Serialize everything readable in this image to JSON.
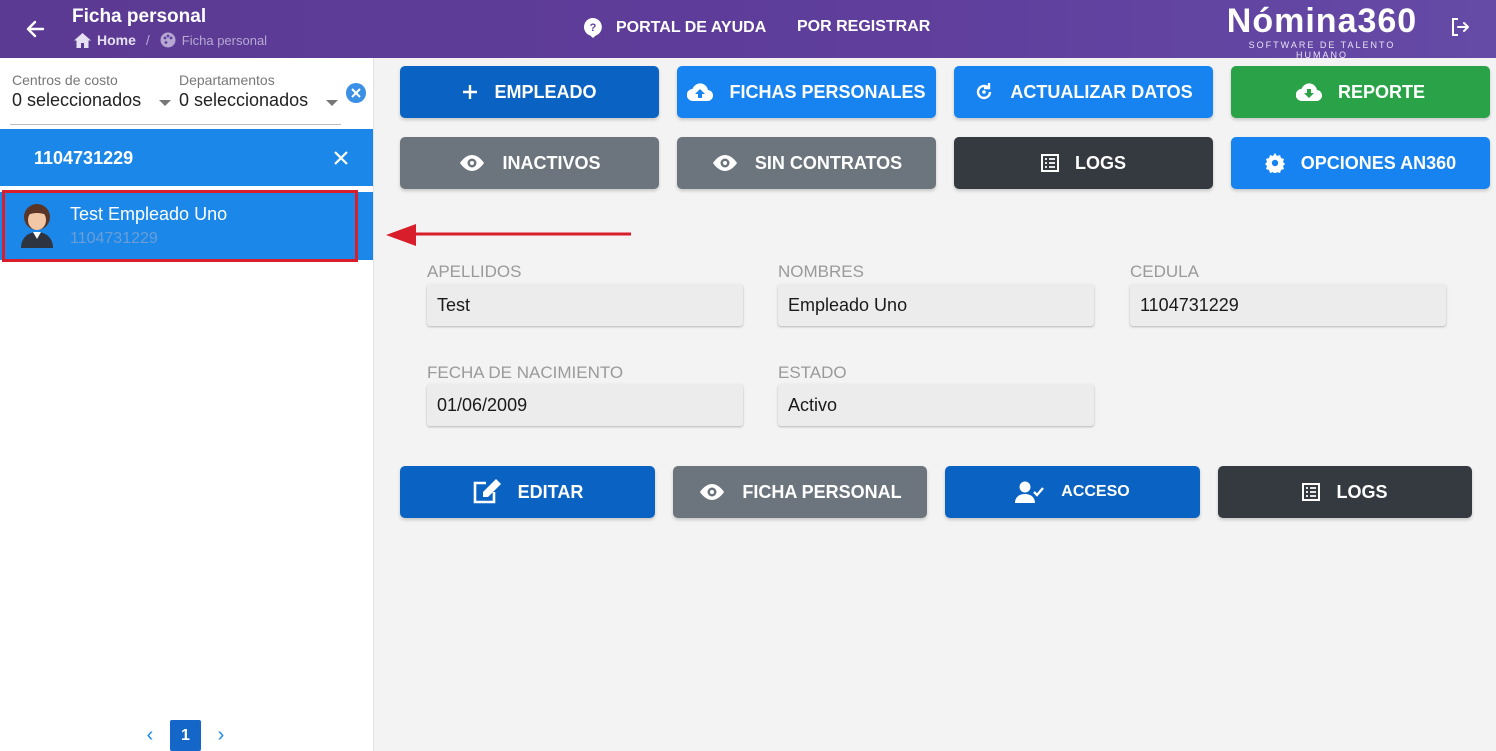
{
  "header": {
    "title": "Ficha personal",
    "breadcrumb_home": "Home",
    "breadcrumb_current": "Ficha personal",
    "help_link": "PORTAL DE AYUDA",
    "register_link": "POR REGISTRAR",
    "logo_main": "Nómina360",
    "logo_sub": "SOFTWARE DE TALENTO HUMANO"
  },
  "sidebar": {
    "cost_centers_label": "Centros de costo",
    "cost_centers_value": "0 seleccionados",
    "departments_label": "Departamentos",
    "departments_value": "0 seleccionados",
    "search_value": "1104731229",
    "employee": {
      "name": "Test Empleado Uno",
      "id": "1104731229"
    },
    "current_page": "1"
  },
  "actions": {
    "empleado": "EMPLEADO",
    "fichas_personales": "FICHAS PERSONALES",
    "actualizar_datos": "ACTUALIZAR DATOS",
    "reporte": "REPORTE",
    "inactivos": "INACTIVOS",
    "sin_contratos": "SIN CONTRATOS",
    "logs": "LOGS",
    "opciones": "OPCIONES AN360"
  },
  "details": {
    "apellidos_label": "APELLIDOS",
    "apellidos": "Test",
    "nombres_label": "NOMBRES",
    "nombres": "Empleado Uno",
    "cedula_label": "CEDULA",
    "cedula": "1104731229",
    "fecha_label": "FECHA DE NACIMIENTO",
    "fecha": "01/06/2009",
    "estado_label": "ESTADO",
    "estado": "Activo"
  },
  "bottom_actions": {
    "editar": "EDITAR",
    "ficha_personal": "FICHA PERSONAL",
    "acceso": "ACCESO",
    "logs": "LOGS"
  },
  "colors": {
    "header": "#5f3e9c",
    "primary": "#0a62c2",
    "info": "#1683f0",
    "success": "#2aa348",
    "secondary": "#6c757d",
    "dark": "#343a40",
    "highlight": "#d81e2a"
  }
}
